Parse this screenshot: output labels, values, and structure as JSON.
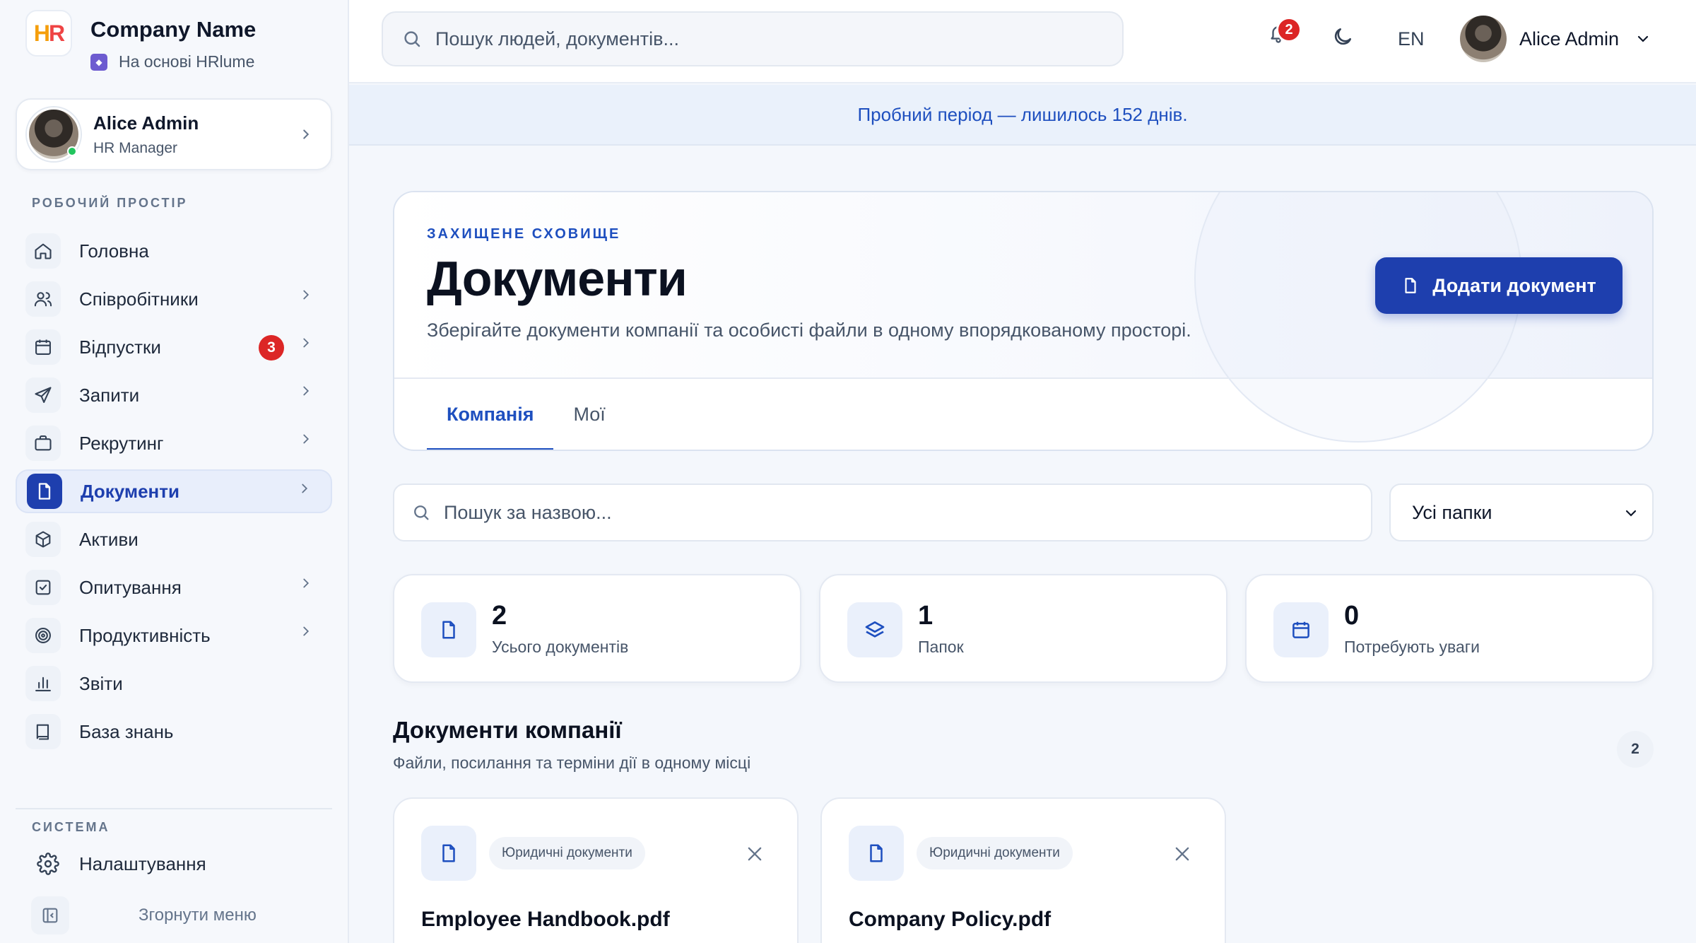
{
  "brand": {
    "name": "Company Name",
    "powered_by": "На основі HRlume",
    "logo_h": "H",
    "logo_r": "R"
  },
  "sidebar": {
    "user": {
      "name": "Alice Admin",
      "role": "HR Manager"
    },
    "workspace_label": "РОБОЧИЙ ПРОСТІР",
    "items": [
      {
        "label": "Головна",
        "icon": "home-icon"
      },
      {
        "label": "Співробітники",
        "icon": "users-icon"
      },
      {
        "label": "Відпустки",
        "icon": "calendar-icon",
        "badge": "3"
      },
      {
        "label": "Запити",
        "icon": "send-icon"
      },
      {
        "label": "Рекрутинг",
        "icon": "briefcase-icon"
      },
      {
        "label": "Документи",
        "icon": "document-icon"
      },
      {
        "label": "Активи",
        "icon": "box-icon"
      },
      {
        "label": "Опитування",
        "icon": "checkbox-icon"
      },
      {
        "label": "Продуктивність",
        "icon": "target-icon"
      },
      {
        "label": "Звіти",
        "icon": "bar-chart-icon"
      },
      {
        "label": "База знань",
        "icon": "book-icon"
      }
    ],
    "system_label": "СИСТЕМА",
    "settings_label": "Налаштування",
    "collapse_label": "Згорнути меню"
  },
  "topbar": {
    "search_placeholder": "Пошук людей, документів...",
    "notifications_count": "2",
    "language": "EN",
    "user_name": "Alice Admin"
  },
  "trial_banner": "Пробний період — лишилось 152 днів.",
  "hero": {
    "eyebrow": "ЗАХИЩЕНЕ СХОВИЩЕ",
    "title": "Документи",
    "description": "Зберігайте документи компанії та особисті файли в одному впорядкованому просторі.",
    "add_button": "Додати документ",
    "tabs": [
      "Компанія",
      "Мої"
    ]
  },
  "filters": {
    "search_placeholder": "Пошук за назвою...",
    "folder_selected": "Усі папки"
  },
  "stats": [
    {
      "value": "2",
      "caption": "Усього документів",
      "icon": "document-icon"
    },
    {
      "value": "1",
      "caption": "Папок",
      "icon": "layers-icon"
    },
    {
      "value": "0",
      "caption": "Потребують уваги",
      "icon": "calendar-icon"
    }
  ],
  "section": {
    "title": "Документи компанії",
    "subtitle": "Файли, посилання та терміни дії в одному місці",
    "count": "2"
  },
  "documents": [
    {
      "tag": "Юридичні документи",
      "name": "Employee Handbook.pdf"
    },
    {
      "tag": "Юридичні документи",
      "name": "Company Policy.pdf"
    }
  ],
  "colors": {
    "accent": "#1e3fae",
    "badge": "#dc2626",
    "online": "#22c55e"
  }
}
